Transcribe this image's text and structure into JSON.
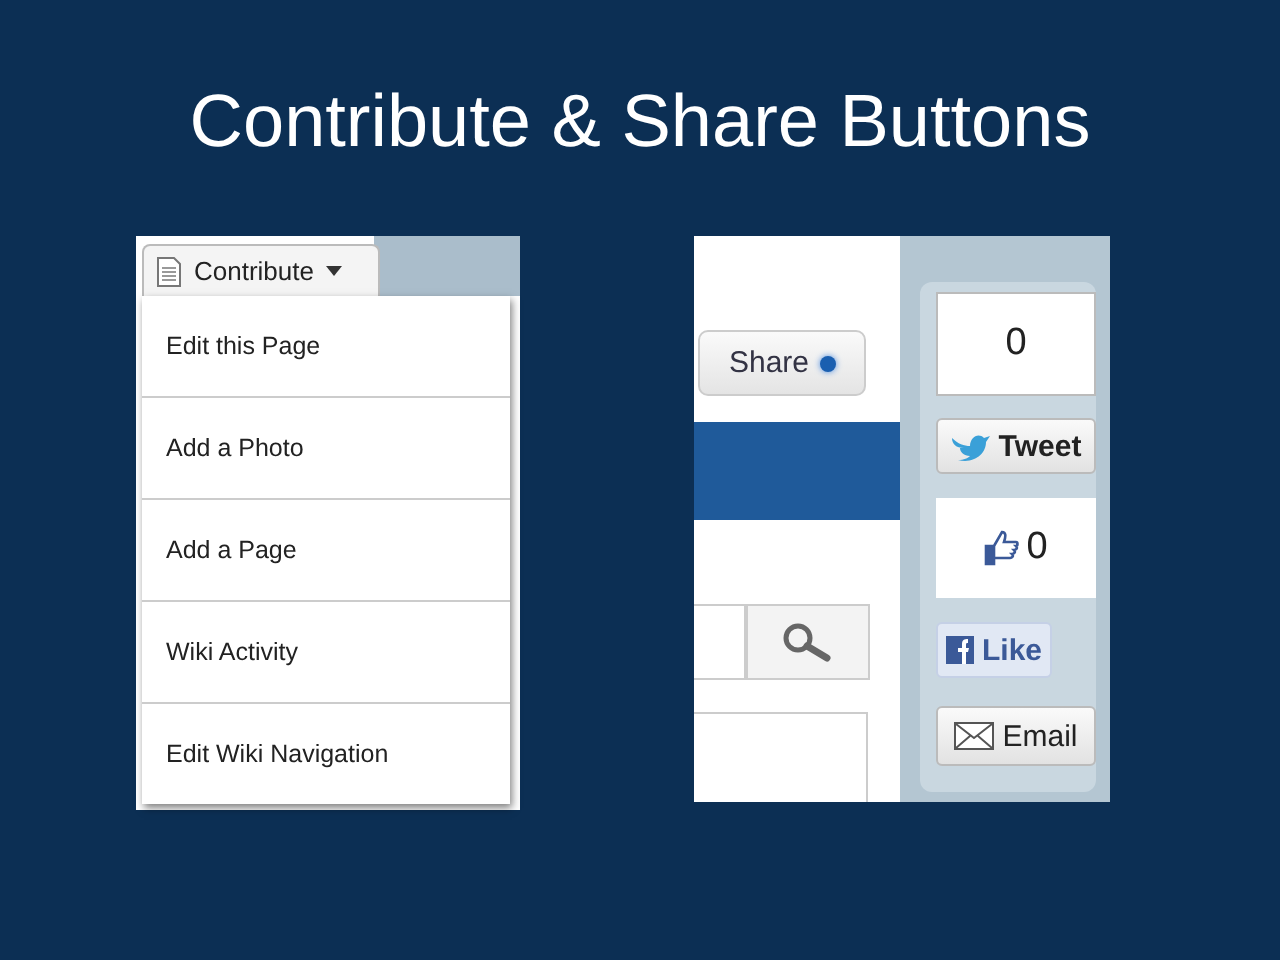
{
  "title": "Contribute & Share Buttons",
  "contribute": {
    "label": "Contribute",
    "expanded": true,
    "menu": [
      {
        "label": "Edit this Page"
      },
      {
        "label": "Add a Photo"
      },
      {
        "label": "Add a Page"
      },
      {
        "label": "Wiki Activity"
      },
      {
        "label": "Edit Wiki Navigation"
      }
    ]
  },
  "share": {
    "label": "Share",
    "tweet_count": "0",
    "tweet_label": "Tweet",
    "like_count": "0",
    "like_label": "Like",
    "email_label": "Email"
  }
}
